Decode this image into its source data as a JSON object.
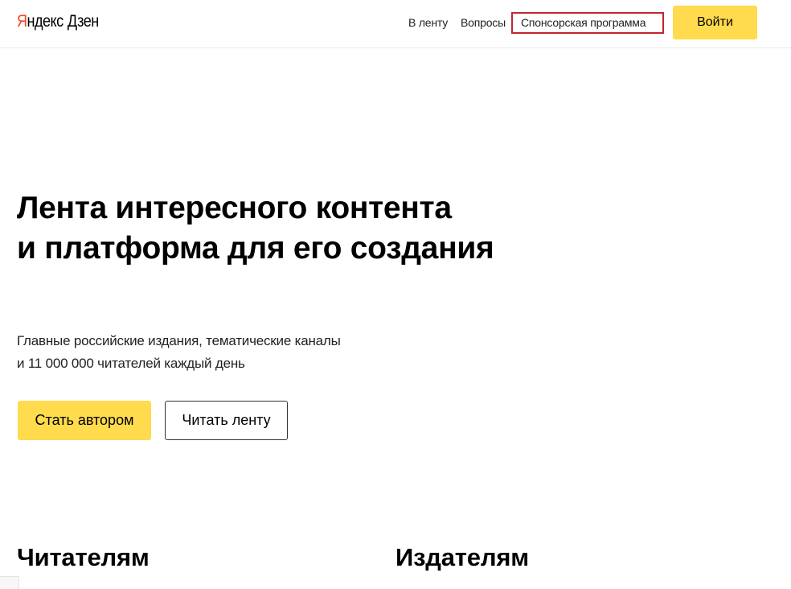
{
  "header": {
    "logo": {
      "brand_first_letter": "Я",
      "brand_rest": "ндекс",
      "product": "Дзен"
    },
    "nav": {
      "feed_label": "В ленту",
      "questions_label": "Вопросы",
      "sponsor_label": "Спонсорская программа"
    },
    "login_label": "Войти"
  },
  "hero": {
    "title_line1": "Лента интересного контента",
    "title_line2": "и платформа для его создания",
    "subtitle_line1": "Главные российские издания, тематические каналы",
    "subtitle_line2": "и 11 000 000 читателей каждый день",
    "become_author_label": "Стать автором",
    "read_feed_label": "Читать ленту"
  },
  "sections": {
    "readers_heading": "Читателям",
    "publishers_heading": "Издателям"
  },
  "colors": {
    "accent_yellow": "#ffdb4d",
    "brand_red": "#fc3f1d",
    "highlight_border": "#c1272d"
  }
}
